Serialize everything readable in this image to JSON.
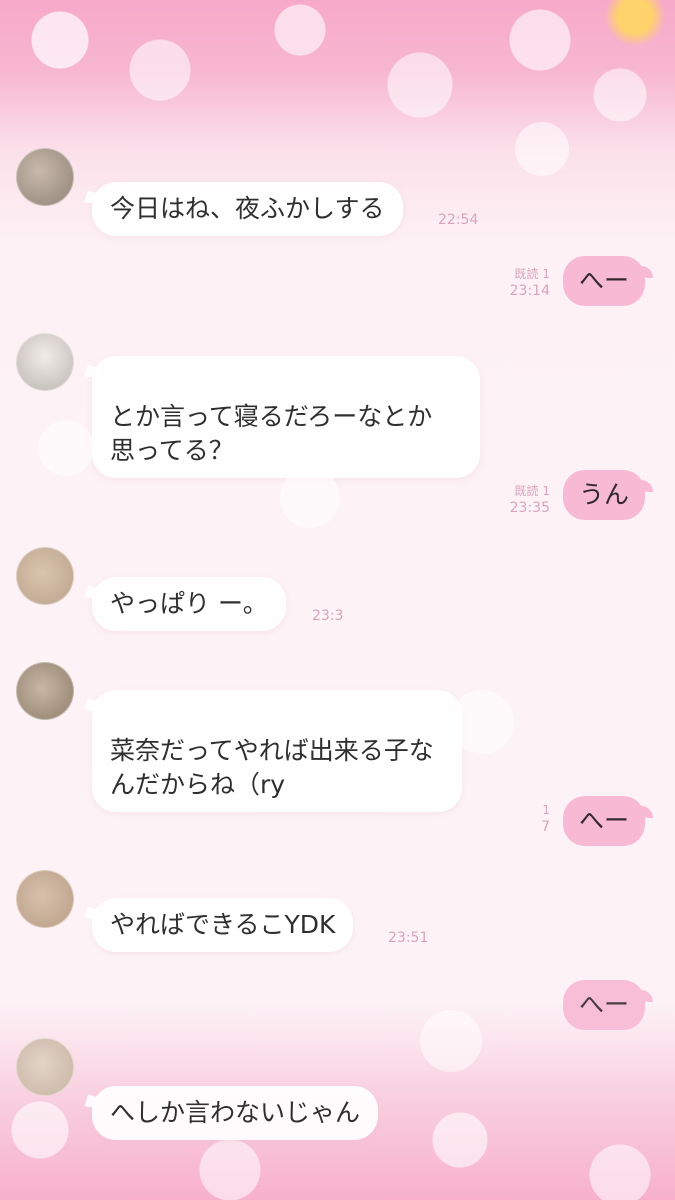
{
  "messages": [
    {
      "side": "left",
      "text": "今日はね、夜ふかしする",
      "time": "22:54"
    },
    {
      "side": "right",
      "text": "へー",
      "read": "既読 1",
      "time": "23:14"
    },
    {
      "side": "left",
      "text": "とか言って寝るだろーなとか\n思ってる？",
      "time": ""
    },
    {
      "side": "right",
      "text": "うん",
      "read": "既読 1",
      "time": "23:35"
    },
    {
      "side": "left",
      "text": "やっぱり ー。",
      "time": "23:3"
    },
    {
      "side": "left",
      "text": "菜奈だってやれば出来る子な\nんだからね（ry",
      "time": ""
    },
    {
      "side": "right",
      "text": "へー",
      "read": "1",
      "time": "7"
    },
    {
      "side": "left",
      "text": "やればできるこYDK",
      "time": "23:51"
    },
    {
      "side": "right",
      "text": "へー",
      "read": "",
      "time": ""
    },
    {
      "side": "left",
      "text": "へしか言わないじゃん",
      "time": ""
    }
  ],
  "colors": {
    "accent": "#f8b9d5",
    "timestamp": "#d9a3bc",
    "bubble_left": "#ffffff"
  }
}
